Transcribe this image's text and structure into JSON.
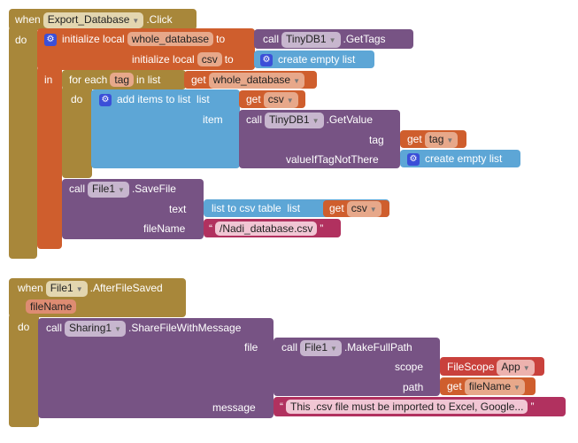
{
  "block1": {
    "when": "when",
    "component": "Export_Database",
    "event": ".Click",
    "do": "do",
    "in": "in",
    "init1": "initialize local",
    "var1": "whole_database",
    "to": "to",
    "init2": "initialize local",
    "var2": "csv",
    "call": "call",
    "tinydb": "TinyDB1",
    "gettags": ".GetTags",
    "create_empty": "create empty list",
    "foreach": "for each",
    "tagvar": "tag",
    "inlist": "in list",
    "get": "get",
    "add_items": "add items to list",
    "list": "list",
    "item": "item",
    "getvalue": ".GetValue",
    "tag_label": "tag",
    "value_if": "valueIfTagNotThere",
    "file1": "File1",
    "savefile": ".SaveFile",
    "text_label": "text",
    "filename_label": "fileName",
    "list_to_csv": "list to csv table",
    "filename_value": "/Nadi_database.csv"
  },
  "block2": {
    "when": "when",
    "component": "File1",
    "event": ".AfterFileSaved",
    "param": "fileName",
    "do": "do",
    "call": "call",
    "sharing": "Sharing1",
    "method": ".ShareFileWithMessage",
    "file_label": "file",
    "message_label": "message",
    "makefullpath": ".MakeFullPath",
    "scope_label": "scope",
    "path_label": "path",
    "filescope": "FileScope",
    "app": "App",
    "get": "get",
    "filename_var": "fileName",
    "message_value": "This .csv file must be imported to Excel, Google..."
  },
  "colors": {
    "event": "#A8873A",
    "variable": "#CF5E2D",
    "component": "#775384",
    "list": "#5DA6D6",
    "text": "#B1315F",
    "filescope": "#C9413C"
  }
}
